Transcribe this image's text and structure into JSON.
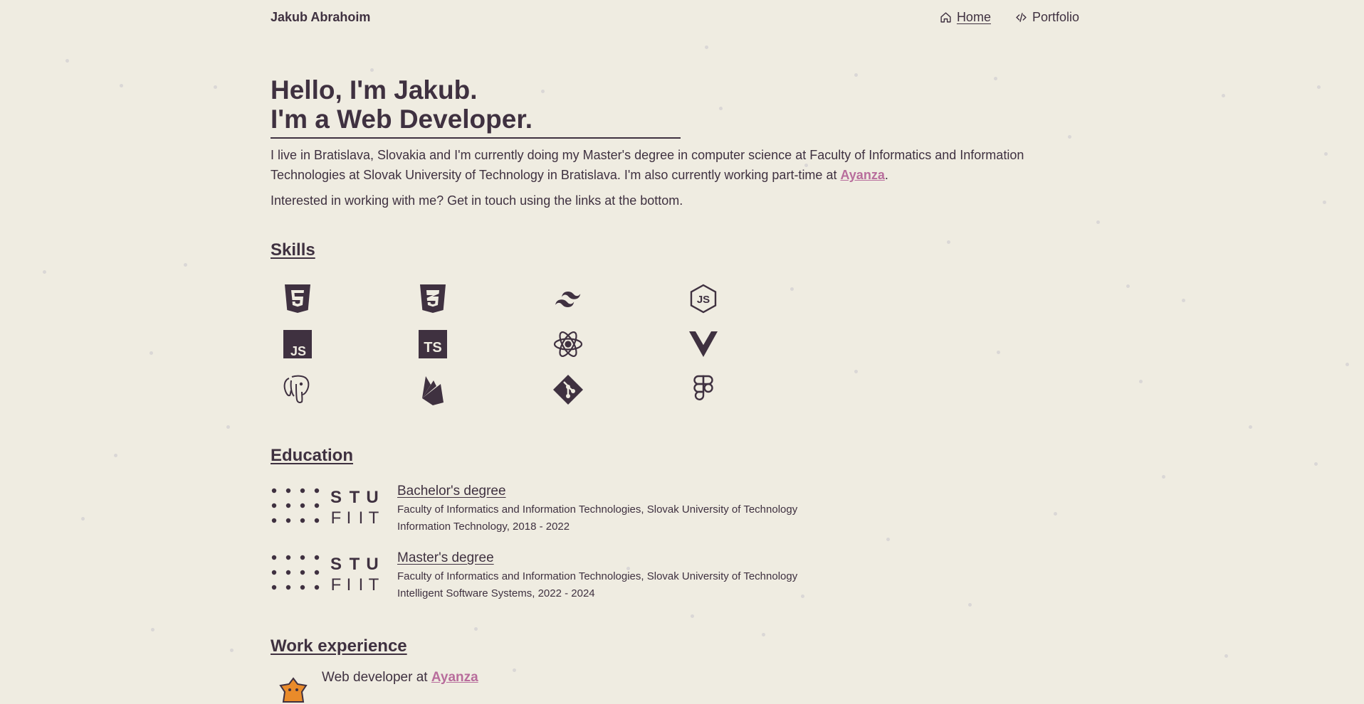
{
  "header": {
    "brand": "Jakub Abrahoim",
    "nav": [
      {
        "label": "Home"
      },
      {
        "label": "Portfolio"
      }
    ]
  },
  "hero": {
    "line1": "Hello, I'm Jakub.",
    "line2": "I'm a Web Developer.",
    "bio_before": "I live in Bratislava, Slovakia and I'm currently doing my Master's degree in computer science at Faculty of Informatics and Information Technologies at Slovak University of Technology in Bratislava. I'm also currently working part-time at ",
    "bio_link": "Ayanza",
    "bio_after": ".",
    "cta": "Interested in working with me? Get in touch using the links at the bottom."
  },
  "skills": {
    "title": "Skills",
    "icons": [
      "html5-icon",
      "css3-icon",
      "tailwind-icon",
      "nodejs-icon",
      "javascript-icon",
      "typescript-icon",
      "react-icon",
      "vue-icon",
      "postgresql-icon",
      "firebase-icon",
      "git-icon",
      "figma-icon"
    ]
  },
  "education": {
    "title": "Education",
    "logo_text": [
      "S",
      "T",
      "U",
      "F",
      "I",
      "I",
      "T"
    ],
    "items": [
      {
        "degree": "Bachelor's degree",
        "school": "Faculty of Informatics and Information Technologies, Slovak University of Technology",
        "detail": "Information Technology, 2018 - 2022"
      },
      {
        "degree": "Master's degree",
        "school": "Faculty of Informatics and Information Technologies, Slovak University of Technology",
        "detail": "Intelligent Software Systems, 2022 - 2024"
      }
    ]
  },
  "work": {
    "title": "Work experience",
    "role_prefix": "Web developer at ",
    "company": "Ayanza"
  },
  "colors": {
    "background": "#efece1",
    "text": "#3f3140",
    "accent": "#b86d9c"
  }
}
